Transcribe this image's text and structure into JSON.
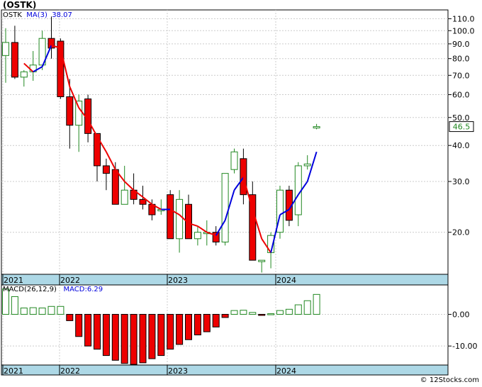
{
  "title": "(OSTK)",
  "credit": "© 12Stocks.com",
  "price_legend": {
    "ticker": "OSTK",
    "ma_label": "MA(3)",
    "ma_value": "38.07",
    "last_price": "46.5"
  },
  "macd_legend": {
    "label": "MACD(26,12,9)",
    "value_label": "MACD:6.29"
  },
  "colors": {
    "up": "#228822",
    "down": "#ee0000",
    "ma_rising": "#0000dd",
    "ma_falling": "#ee0000",
    "axis_band": "#add8e6",
    "grid": "#cccccc"
  },
  "chart_data": [
    {
      "type": "candlestick",
      "scale": "log",
      "ylim": [
        14.3,
        118
      ],
      "x_ticks": [
        "2021",
        "2022",
        "2023",
        "2024"
      ],
      "y_ticks": [
        "110.0",
        "100.0",
        "90.0",
        "80.0",
        "70.0",
        "60.0",
        "50.0",
        "40.0",
        "30.0",
        "20.0"
      ],
      "y_tick_values": [
        110,
        100,
        90,
        80,
        70,
        60,
        50,
        40,
        30,
        20
      ],
      "candles": [
        {
          "o": 82,
          "h": 102,
          "l": 66,
          "c": 91
        },
        {
          "o": 91,
          "h": 104,
          "l": 68,
          "c": 69
        },
        {
          "o": 69,
          "h": 73,
          "l": 64,
          "c": 72
        },
        {
          "o": 72,
          "h": 85,
          "l": 67,
          "c": 76
        },
        {
          "o": 76,
          "h": 100,
          "l": 73,
          "c": 94
        },
        {
          "o": 94,
          "h": 112,
          "l": 80,
          "c": 87
        },
        {
          "o": 92,
          "h": 94,
          "l": 58,
          "c": 59
        },
        {
          "o": 59,
          "h": 68,
          "l": 39,
          "c": 47
        },
        {
          "o": 47,
          "h": 60,
          "l": 38,
          "c": 57
        },
        {
          "o": 58,
          "h": 60,
          "l": 41,
          "c": 44
        },
        {
          "o": 44,
          "h": 44,
          "l": 30,
          "c": 34
        },
        {
          "o": 34,
          "h": 36,
          "l": 28,
          "c": 32
        },
        {
          "o": 33,
          "h": 35,
          "l": 25,
          "c": 25
        },
        {
          "o": 25,
          "h": 34,
          "l": 25,
          "c": 28
        },
        {
          "o": 28,
          "h": 32,
          "l": 25,
          "c": 26
        },
        {
          "o": 26,
          "h": 29,
          "l": 24,
          "c": 25
        },
        {
          "o": 25,
          "h": 26,
          "l": 22,
          "c": 23
        },
        {
          "o": 24,
          "h": 26,
          "l": 23,
          "c": 24
        },
        {
          "o": 27,
          "h": 28,
          "l": 19,
          "c": 19
        },
        {
          "o": 19,
          "h": 28,
          "l": 17,
          "c": 26
        },
        {
          "o": 25,
          "h": 27,
          "l": 19,
          "c": 19
        },
        {
          "o": 19,
          "h": 21,
          "l": 18,
          "c": 20
        },
        {
          "o": 20,
          "h": 22,
          "l": 18,
          "c": 20
        },
        {
          "o": 20,
          "h": 21,
          "l": 18,
          "c": 18.5
        },
        {
          "o": 18.5,
          "h": 32,
          "l": 18,
          "c": 32
        },
        {
          "o": 33,
          "h": 39,
          "l": 32,
          "c": 38
        },
        {
          "o": 36,
          "h": 39,
          "l": 25,
          "c": 27
        },
        {
          "o": 27,
          "h": 30,
          "l": 16,
          "c": 16
        },
        {
          "o": 16,
          "h": 16,
          "l": 14.5,
          "c": 16
        },
        {
          "o": 17,
          "h": 20,
          "l": 15,
          "c": 19.5
        },
        {
          "o": 20,
          "h": 29,
          "l": 19,
          "c": 28
        },
        {
          "o": 28,
          "h": 29,
          "l": 21,
          "c": 22
        },
        {
          "o": 23,
          "h": 35,
          "l": 21,
          "c": 34
        },
        {
          "o": 34,
          "h": 37,
          "l": 33,
          "c": 34.5
        },
        {
          "o": 46.5,
          "h": 47.5,
          "l": 45.5,
          "c": 46.5
        }
      ],
      "ma": [
        null,
        null,
        77,
        72,
        75,
        89,
        87,
        64,
        54,
        49,
        43,
        38,
        33,
        30,
        28,
        26.5,
        25,
        24,
        24,
        23,
        21.5,
        21,
        20,
        19.5,
        22,
        28,
        31,
        24,
        19,
        17,
        23,
        24,
        27,
        30,
        38
      ]
    },
    {
      "type": "bar",
      "title": "MACD(26,12,9)",
      "ylim": [
        -16,
        9.5
      ],
      "y_ticks": [
        "0.00",
        "-10.00"
      ],
      "y_tick_values": [
        0,
        -10
      ],
      "values": [
        8,
        5.6,
        2,
        2.1,
        2,
        2.5,
        2.5,
        -2,
        -7,
        -10,
        -11,
        -13,
        -14.5,
        -15.5,
        -15.8,
        -15.3,
        -14,
        -13,
        -11,
        -9.5,
        -8,
        -6.5,
        -5.5,
        -4,
        -1,
        1.2,
        1.3,
        0.6,
        -0.2,
        0.2,
        1.2,
        1.6,
        3,
        4.3,
        6.29
      ]
    }
  ]
}
